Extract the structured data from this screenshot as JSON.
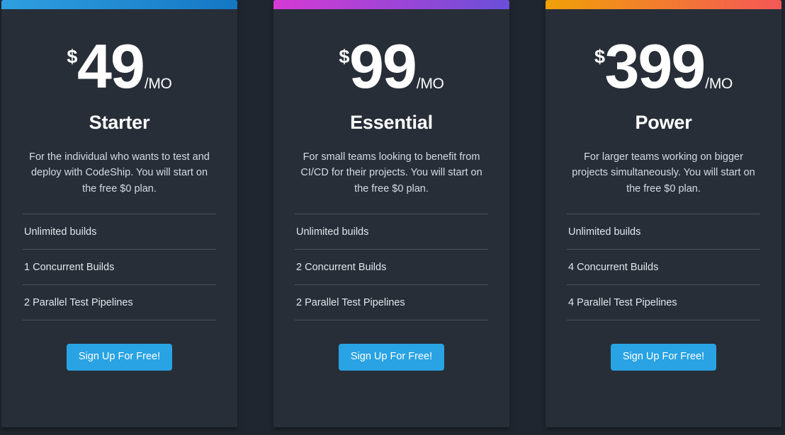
{
  "page": {
    "background_color": "#20262f",
    "card_background_color": "#272e38",
    "divider_color": "#4a525f",
    "cta_color": "#29a3e3"
  },
  "plans": [
    {
      "accent_from": "#2f9fe0",
      "accent_to": "#1577c4",
      "currency": "$",
      "amount": "49",
      "period": "/MO",
      "title": "Starter",
      "description": "For the individual who wants to test and deploy with CodeShip. You will start on the free $0 plan.",
      "features": [
        "Unlimited builds",
        "1 Concurrent Builds",
        "2 Parallel Test Pipelines"
      ],
      "cta_label": "Sign Up For Free!"
    },
    {
      "accent_from": "#d63ad4",
      "accent_to": "#6a4fd8",
      "currency": "$",
      "amount": "99",
      "period": "/MO",
      "title": "Essential",
      "description": "For small teams looking to benefit from CI/CD for their projects. You will start on the free $0 plan.",
      "features": [
        "Unlimited builds",
        "2 Concurrent Builds",
        "2 Parallel Test Pipelines"
      ],
      "cta_label": "Sign Up For Free!"
    },
    {
      "accent_from": "#f0a008",
      "accent_to": "#f45757",
      "currency": "$",
      "amount": "399",
      "period": "/MO",
      "title": "Power",
      "description": "For larger teams working on bigger projects simultaneously. You will start on the free $0 plan.",
      "features": [
        "Unlimited builds",
        "4 Concurrent Builds",
        "4 Parallel Test Pipelines"
      ],
      "cta_label": "Sign Up For Free!"
    }
  ]
}
